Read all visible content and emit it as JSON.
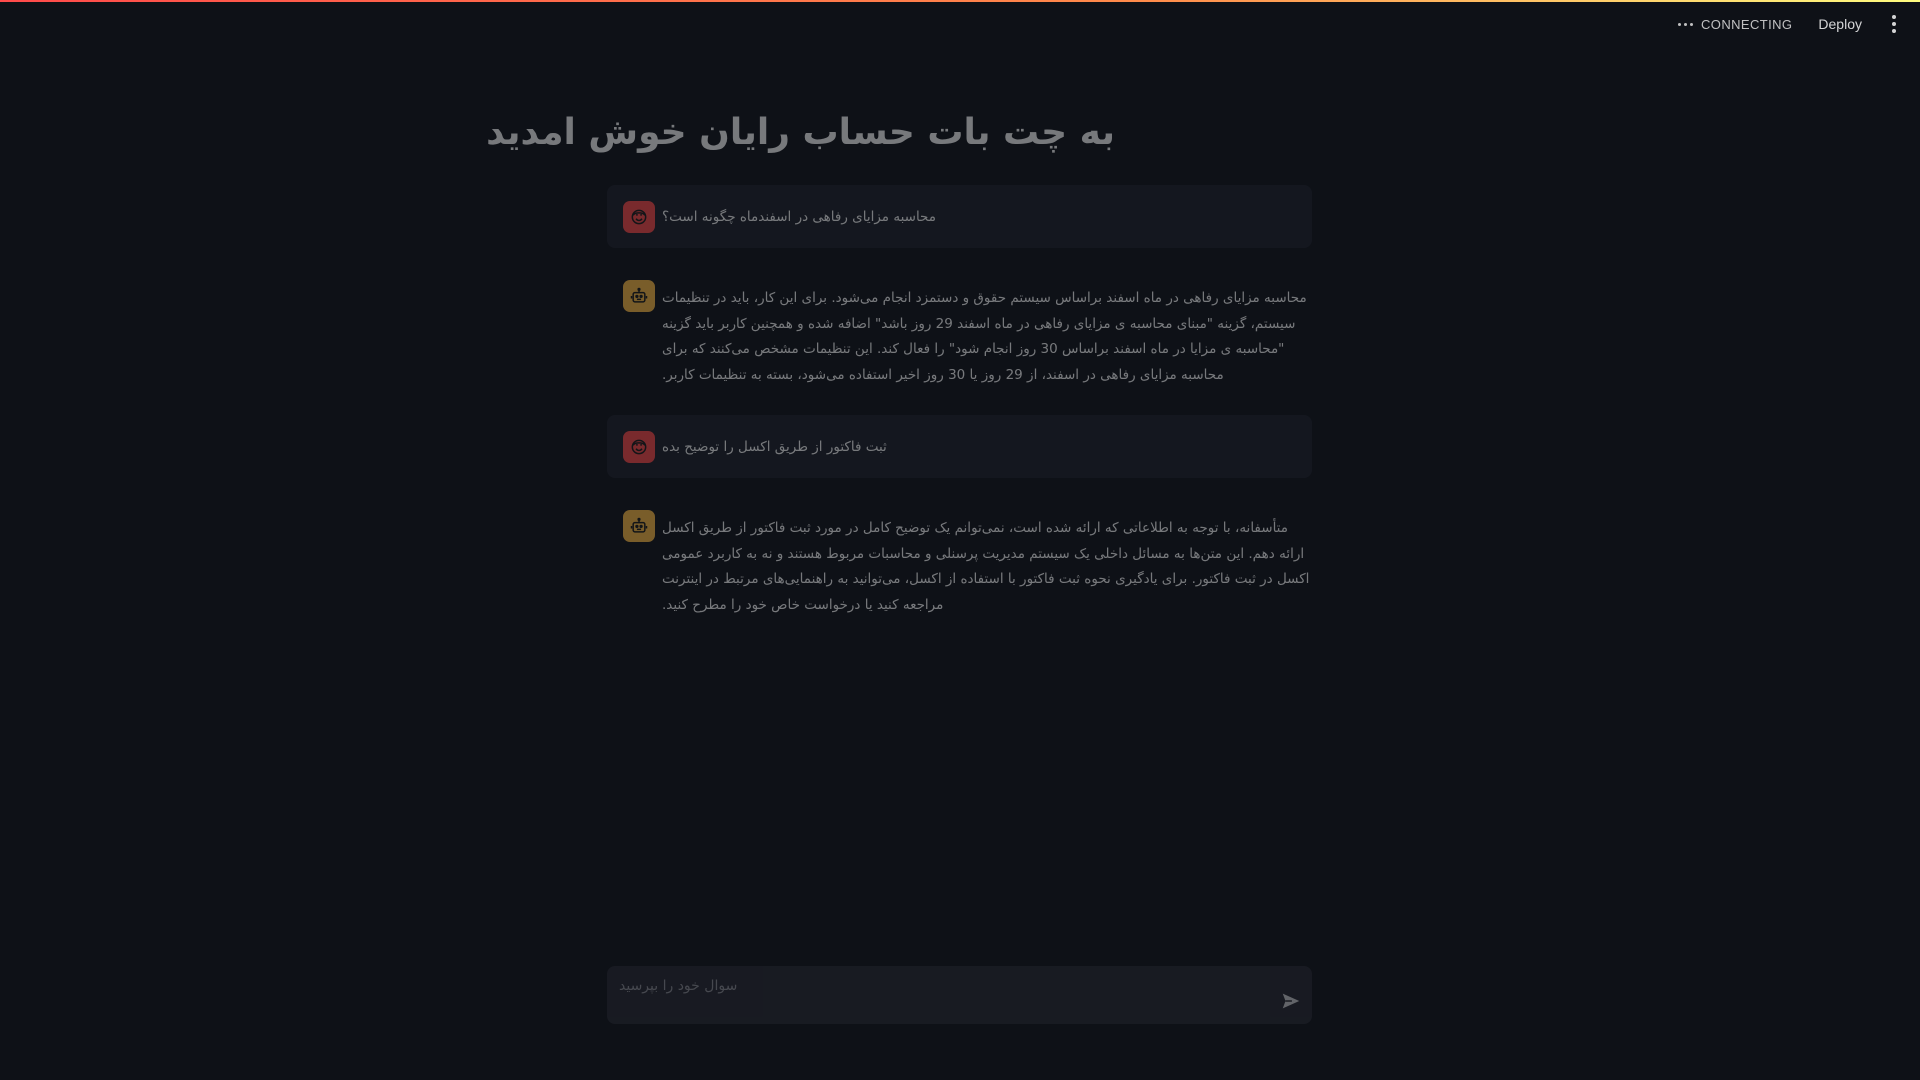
{
  "header": {
    "status_label": "CONNECTING",
    "deploy_label": "Deploy"
  },
  "page": {
    "title": "به چت بات حساب رایان خوش امدید"
  },
  "messages": [
    {
      "role": "user",
      "text": "محاسبه مزایای رفاهی در اسفندماه چگونه است؟"
    },
    {
      "role": "assistant",
      "text": "محاسبه مزایای رفاهی در ماه اسفند براساس سیستم حقوق و دستمزد انجام می‌شود. برای این کار، باید در تنظیمات سیستم، گزینه \"مبنای محاسبه ی مزایای رفاهی در ماه اسفند 29 روز باشد\" اضافه شده و همچنین کاربر باید گزینه \"محاسبه ی مزایا در ماه اسفند براساس 30 روز انجام شود\" را فعال کند. این تنظیمات مشخص می‌کنند که برای محاسبه مزایای رفاهی در اسفند، از 29 روز یا 30 روز اخیر استفاده می‌شود، بسته به تنظیمات کاربر."
    },
    {
      "role": "user",
      "text": "ثبت فاکتور از طریق اکسل را توضیح بده"
    },
    {
      "role": "assistant",
      "text": "متأسفانه، با توجه به اطلاعاتی که ارائه شده است، نمی‌توانم یک توضیح کامل در مورد ثبت فاکتور از طریق اکسل ارائه دهم. این متن‌ها به مسائل داخلی یک سیستم مدیریت پرسنلی و محاسبات مربوط هستند و نه به کاربرد عمومی اکسل در ثبت فاکتور. برای یادگیری نحوه ثبت فاکتور با استفاده از اکسل، می‌توانید به راهنمایی‌های مرتبط در اینترنت مراجعه کنید یا درخواست خاص خود را مطرح کنید."
    }
  ],
  "chat_input": {
    "placeholder": "سوال خود را بپرسید"
  },
  "colors": {
    "background": "#0e1117",
    "user_avatar": "#ff4b4b",
    "assistant_avatar": "#ffbd45",
    "user_bubble": "#1e212b"
  },
  "icons": {
    "user_avatar": "face-icon",
    "assistant_avatar": "robot-icon",
    "send": "send-icon",
    "status": "dots-icon",
    "menu": "kebab-menu-icon"
  }
}
